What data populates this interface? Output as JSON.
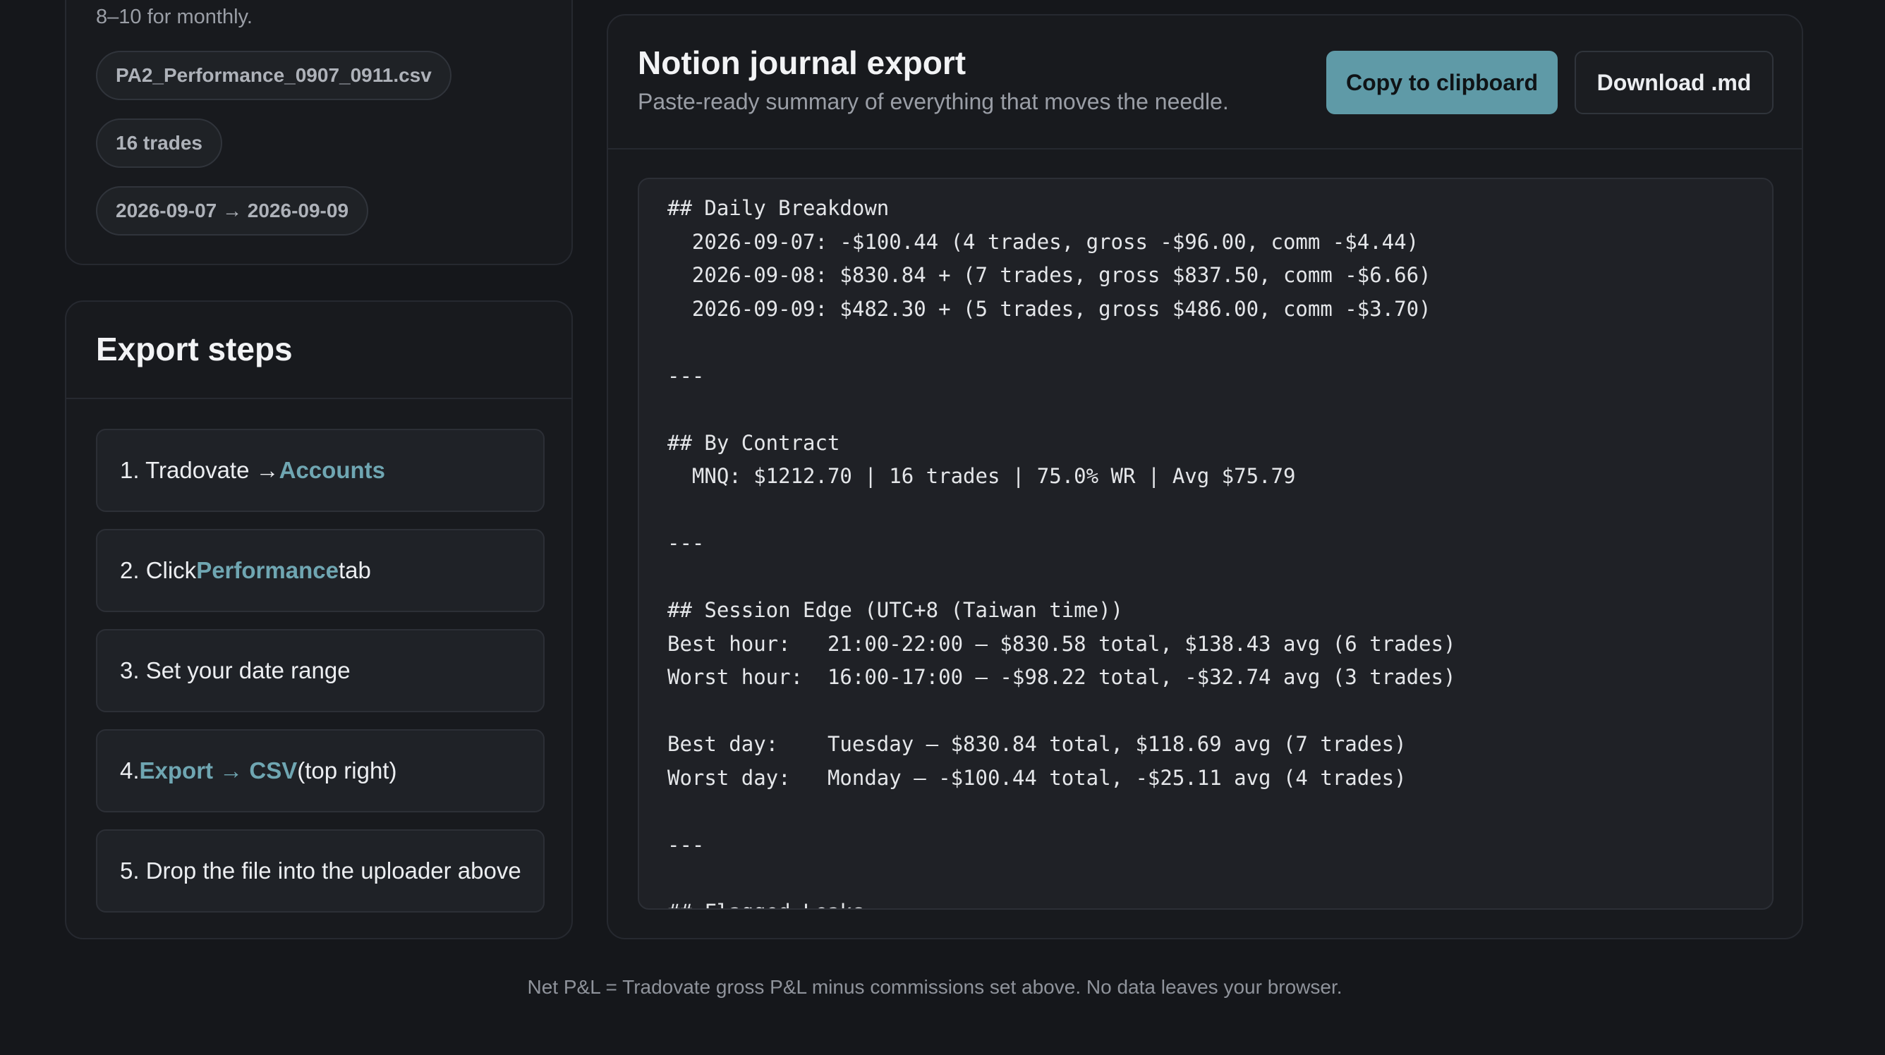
{
  "file_card": {
    "note": "8–10 for monthly.",
    "file_name": "PA2_Performance_0907_0911.csv",
    "trades": "16 trades",
    "date_range": "2026-09-07 → 2026-09-09"
  },
  "steps": {
    "title": "Export steps",
    "items": [
      {
        "prefix": "1. Tradovate → ",
        "highlight": "Accounts",
        "suffix": ""
      },
      {
        "prefix": "2. Click ",
        "highlight": "Performance",
        "suffix": " tab"
      },
      {
        "prefix": "3. Set your date range",
        "highlight": "",
        "suffix": ""
      },
      {
        "prefix": "4. ",
        "highlight": "Export → CSV",
        "suffix": " (top right)"
      },
      {
        "prefix": "5. Drop the file into the uploader above",
        "highlight": "",
        "suffix": ""
      }
    ]
  },
  "export": {
    "title": "Notion journal export",
    "subtitle": "Paste-ready summary of everything that moves the needle.",
    "copy_label": "Copy to clipboard",
    "download_label": "Download .md",
    "content": "## Daily Breakdown\n  2026-09-07: -$100.44 (4 trades, gross -$96.00, comm -$4.44)\n  2026-09-08: $830.84 + (7 trades, gross $837.50, comm -$6.66)\n  2026-09-09: $482.30 + (5 trades, gross $486.00, comm -$3.70)\n\n---\n\n## By Contract\n  MNQ: $1212.70 | 16 trades | 75.0% WR | Avg $75.79\n\n---\n\n## Session Edge (UTC+8 (Taiwan time))\nBest hour:   21:00-22:00 — $830.58 total, $138.43 avg (6 trades)\nWorst hour:  16:00-17:00 — -$98.22 total, -$32.74 avg (3 trades)\n\nBest day:    Tuesday — $830.84 total, $118.69 avg (7 trades)\nWorst day:   Monday — -$100.44 total, -$25.11 avg (4 trades)\n\n---\n\n## Flagged Leaks"
  },
  "footer": {
    "text": "Net P&L = Tradovate gross P&L minus commissions set above. No data leaves your browser."
  },
  "colors": {
    "background": "#15171b",
    "card": "#181a1e",
    "accent": "#5f9aa7",
    "highlight_text": "#6fa6b2"
  }
}
